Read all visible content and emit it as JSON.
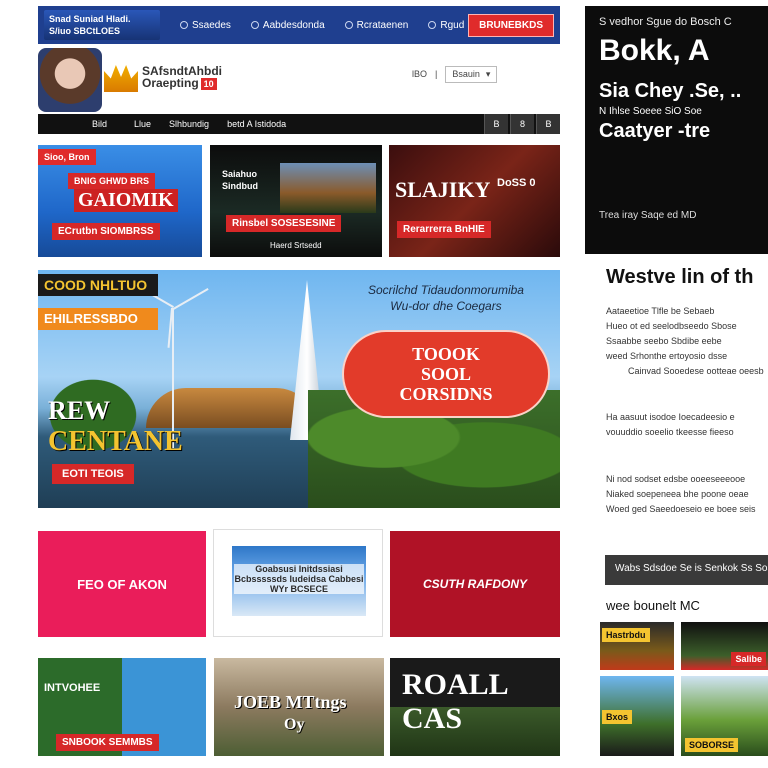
{
  "topnav": {
    "brand_line1": "Snad Suniad Hladi.",
    "brand_line2": "S/iuo SBCtLOES",
    "links": [
      "Ssaedes",
      "Aabdesdonda",
      "Rcrataenen",
      "Rgud"
    ],
    "cta": "BRUNEBKDS"
  },
  "header": {
    "logo_line1": "SAfsndtAhbdi",
    "logo_line2": "Oraepting",
    "logo_badge": "10",
    "search_label": "lBO",
    "select_label": "Bsauin",
    "avatar_caption": "Bild"
  },
  "subnav": {
    "items": [
      "Llue",
      "Slhbundig",
      "betd A Istidoda"
    ],
    "squares": [
      "B",
      "8",
      "B"
    ]
  },
  "tiles_row1": [
    {
      "tag": "Sioo, Bron",
      "title": "BNIG GHWD BRS",
      "subtitle": "GAIOMIK",
      "bar": "ECrutbn SIOMBRSS"
    },
    {
      "tag": "Saiahuo",
      "line": "Sindbud",
      "bar": "Rinsbel SOSESESINE",
      "footer": "Haerd Srtsedd"
    },
    {
      "title": "SLAJIKY",
      "side": "DoSS 0",
      "bar": "Rerarrerra BnHIE"
    }
  ],
  "hero": {
    "label1": "COOD NHLTUO",
    "label2": "EHILRESSBDO",
    "headline_line1": "Socrilchd Tidaudonmorumiba",
    "headline_line2": "Wu-dor dhe Coegars",
    "pill_line1": "TOOOK",
    "pill_line2": "SOOL",
    "pill_line3": "CORSIDNS",
    "new_text": "REW",
    "big_text": "CENTANE",
    "cta": "EOTI TEOIS"
  },
  "tiles_row3": [
    {
      "title": "FEO OF AKON"
    },
    {
      "text": "Goabsusi Initdssiasi Bcbsssssds ludeidsa Cabbesi WYr BCSECE"
    },
    {
      "title": "CSUTH RAFDONY"
    }
  ],
  "tiles_row4": [
    {
      "title": "INTVOHEE",
      "bar": "SNBOOK SEMMBS"
    },
    {
      "title": "JOEB MTtngs",
      "sub": "Oy"
    },
    {
      "title": "ROALL CAS"
    }
  ],
  "right": {
    "top": "S vedhor Sgue do Bosch C",
    "h1": "Bokk, A",
    "h2": "Sia Chey .Se, ..",
    "h3": "N Ihlse Soeee SiO Soe",
    "h4": "Caatyer -tre",
    "foot": "Trea iray Saqe ed MD",
    "section_title": "Westve lin of th",
    "para1": [
      "Aataeetioe Tlfle be Sebaeb",
      "Hueo ot ed seelodbseedo Sbose",
      "Ssaabbe seebo Sbdibe eebe",
      "weed Srhonthe ertoyosio dsse",
      "Cainvad Sooedese ootteae oeesb"
    ],
    "para2": [
      "Ha aasuut isodoe Ioecadeesio e",
      "vouuddio soeelio tkeesse fieeso"
    ],
    "para3": [
      "Ni nod sodset edsbe ooeeseeeooe",
      "Niaked soepeneea bhe poone oeae",
      "Woed ged Saeedoeseio ee boee seis"
    ],
    "bar": "Wabs Sdsdoe Se is Senkok Ss Soak",
    "sub": "wee bounelt MC",
    "thumbs": [
      "Hastrbdu",
      "Salibe",
      "Bxos",
      "SOBORSE"
    ]
  }
}
